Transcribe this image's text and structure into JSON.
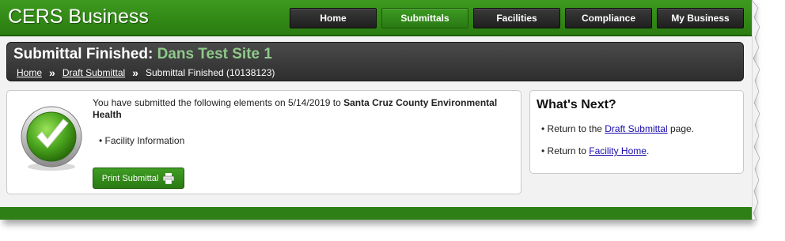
{
  "app": {
    "title": "CERS Business"
  },
  "nav": {
    "items": [
      {
        "label": "Home",
        "active": false
      },
      {
        "label": "Submittals",
        "active": true
      },
      {
        "label": "Facilities",
        "active": false
      },
      {
        "label": "Compliance",
        "active": false
      },
      {
        "label": "My Business",
        "active": false
      }
    ]
  },
  "header": {
    "title_prefix": "Submittal Finished:",
    "site_name": "Dans Test Site 1",
    "breadcrumb": {
      "home": "Home",
      "draft": "Draft Submittal",
      "current": "Submittal Finished (10138123)"
    }
  },
  "submitted": {
    "message_prefix": "You have submitted the following elements on 5/14/2019 to",
    "agency": "Santa Cruz County Environmental Health",
    "elements": [
      "Facility Information"
    ],
    "print_label": "Print Submittal"
  },
  "next": {
    "title": "What's Next?",
    "item1_prefix": "Return to the",
    "item1_link": "Draft Submittal",
    "item1_suffix": "page.",
    "item2_prefix": "Return to",
    "item2_link": "Facility Home",
    "item2_suffix": "."
  },
  "colors": {
    "brand_green": "#2e8a18",
    "nav_dark": "#2b2b2b",
    "site_name_green": "#8fc98a",
    "link_blue": "#1a0dab"
  },
  "icons": {
    "success": "checkmark-circle-icon",
    "print": "printer-icon"
  }
}
